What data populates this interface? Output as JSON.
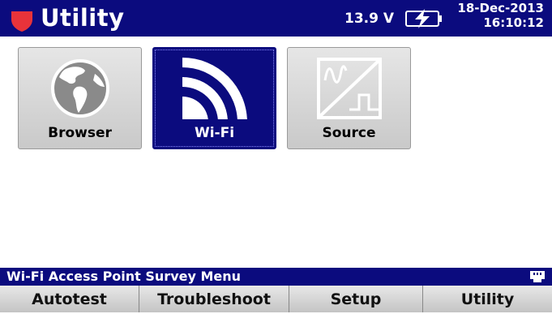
{
  "header": {
    "title": "Utility",
    "voltage": "13.9 V",
    "date": "18-Dec-2013",
    "time": "16:10:12",
    "colors": {
      "bar": "#0b0b7e",
      "shield": "#e8333a"
    },
    "icons": {
      "logo": "shield-logo-icon",
      "battery": "battery-charging-icon"
    }
  },
  "tiles": [
    {
      "label": "Browser",
      "icon": "globe-icon",
      "selected": false
    },
    {
      "label": "Wi-Fi",
      "icon": "wifi-icon",
      "selected": true
    },
    {
      "label": "Source",
      "icon": "signal-source-icon",
      "selected": false
    }
  ],
  "status": {
    "text": "Wi-Fi Access Point Survey Menu",
    "icon": "ethernet-port-icon"
  },
  "softkeys": [
    "Autotest",
    "Troubleshoot",
    "Setup",
    "Utility"
  ]
}
